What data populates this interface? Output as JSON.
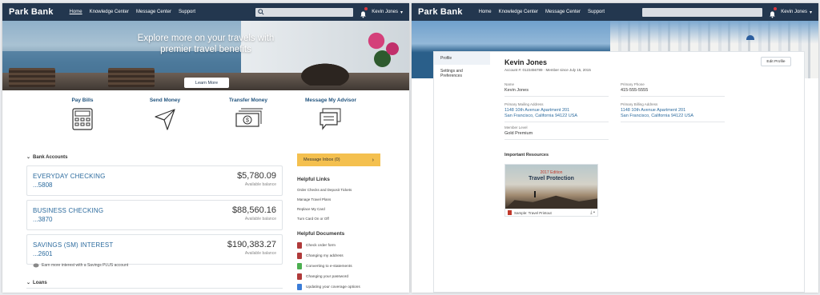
{
  "left": {
    "nav": {
      "brand": "Park Bank",
      "links": [
        "Home",
        "Knowledge Center",
        "Message Center",
        "Support"
      ],
      "user": "Kevin Jones"
    },
    "hero": {
      "line1": "Explore more on your travels with",
      "line2": "premier travel benefits",
      "button": "Learn More"
    },
    "actions": [
      "Pay Bills",
      "Send Money",
      "Transfer Money",
      "Message My Advisor"
    ],
    "bank_accounts_title": "Bank Accounts",
    "accounts": [
      {
        "name": "EVERYDAY CHECKING",
        "number": "...5808",
        "balance": "$5,780.09",
        "balance_label": "Available balance"
      },
      {
        "name": "BUSINESS CHECKING",
        "number": "...3870",
        "balance": "$88,560.16",
        "balance_label": "Available balance"
      },
      {
        "name": "SAVINGS (SM) INTEREST",
        "number": "...2601",
        "balance": "$190,383.27",
        "balance_label": "Available balance"
      }
    ],
    "promo": "Earn more interest with a Savings PLUS account",
    "loans_title": "Loans",
    "inbox": "Message Inbox (0)",
    "helpful_links_title": "Helpful Links",
    "helpful_links": [
      "Order Checks and Deposit Tickets",
      "Manage Travel Plans",
      "Replace My Card",
      "Turn Card On or Off"
    ],
    "helpful_docs_title": "Helpful Documents",
    "helpful_docs": [
      {
        "label": "Check order form",
        "color": "#b03a3a"
      },
      {
        "label": "Changing my address",
        "color": "#b03a3a"
      },
      {
        "label": "Converting to e-statements",
        "color": "#4caf50"
      },
      {
        "label": "Changing your password",
        "color": "#b03a3a"
      },
      {
        "label": "Updating your coverage options",
        "color": "#3b7dd8"
      }
    ]
  },
  "right": {
    "nav": {
      "brand": "Park Bank",
      "links": [
        "Home",
        "Knowledge Center",
        "Message Center",
        "Support"
      ],
      "user": "Kevin Jones"
    },
    "sidenav": [
      "Profile",
      "Settings and Preferences"
    ],
    "profile": {
      "name": "Kevin Jones",
      "account_line": "Account #: 0123456789 · Member since July 15, 2015",
      "edit_button": "Edit Profile",
      "fields": [
        {
          "label": "Name",
          "value": "Kevin Jones"
        },
        {
          "label": "Primary Phone",
          "value": "415-555-5555"
        },
        {
          "label": "Primary Mailing Address",
          "value1": "1148 10th Avenue Apartment 201",
          "value2": "San Francisco, California 94122 USA"
        },
        {
          "label": "Primary Billing Address",
          "value1": "1148 10th Avenue Apartment 201",
          "value2": "San Francisco, California 94122 USA"
        },
        {
          "label": "Member Level",
          "value": "Gold Premium"
        }
      ]
    },
    "resources_title": "Important Resources",
    "resource": {
      "edition": "2017 Edition",
      "title": "Travel Protection",
      "file": "Sample: Travel Printout"
    }
  }
}
